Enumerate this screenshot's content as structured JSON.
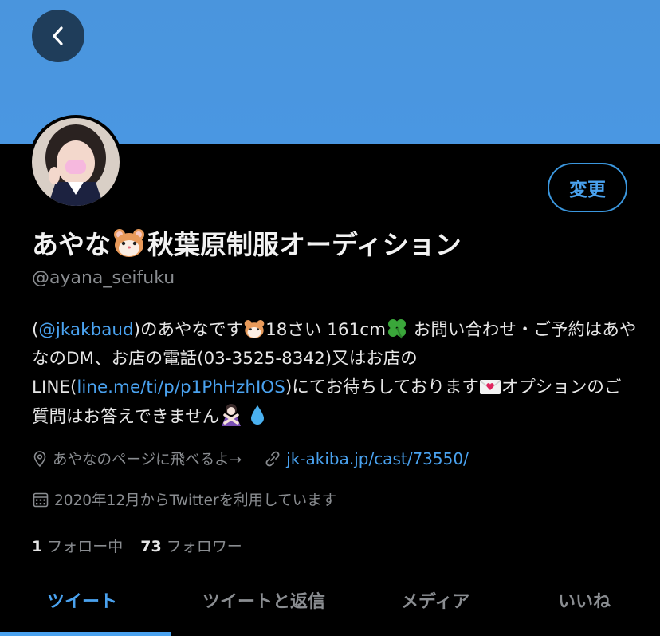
{
  "profile": {
    "name_a": "あやな",
    "name_b": "秋葉原制服オーディション",
    "handle": "@ayana_seifuku",
    "edit_label": "変更"
  },
  "bio": {
    "p1": "(",
    "mention": "@jkakbaud",
    "p2": ")のあやなです",
    "p3": "18さい 161cm",
    "p4": "お問い合わせ・ご予約はあやなのDM、お店の電話(03-3525-8342)又はお店のLINE(",
    "line_link": "line.me/ti/p/p1PhHzhIOS",
    "p5": ")にてお待ちしております",
    "p6": "オプションのご質問はお答えできません"
  },
  "meta": {
    "location": "あやなのページに飛べるよ→",
    "url": "jk-akiba.jp/cast/73550/",
    "joined": "2020年12月からTwitterを利用しています"
  },
  "stats": {
    "following_count": "1",
    "following_label": "フォロー中",
    "followers_count": "73",
    "followers_label": "フォロワー"
  },
  "tabs": [
    "ツイート",
    "ツイートと返信",
    "メディア",
    "いいね"
  ],
  "colors": {
    "accent": "#4aa2ef",
    "banner": "#4a97e2",
    "background": "#000000"
  }
}
